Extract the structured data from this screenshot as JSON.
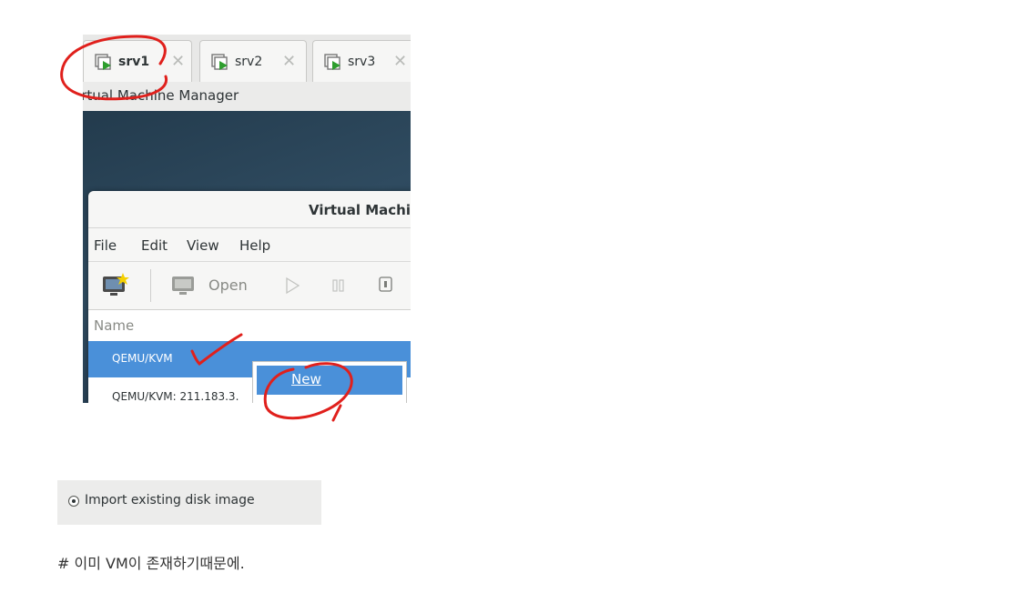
{
  "tabs": [
    {
      "label": "srv1",
      "active": true
    },
    {
      "label": "srv2",
      "active": false
    },
    {
      "label": "srv3",
      "active": false
    }
  ],
  "app_title_partial": "irtual Machine Manager",
  "window_title_partial": "Virtual Machir",
  "menu": [
    "File",
    "Edit",
    "View",
    "Help"
  ],
  "toolbar": {
    "open_label": "Open"
  },
  "list": {
    "column_header": "Name",
    "rows": [
      "QEMU/KVM",
      "QEMU/KVM: 211.183.3."
    ]
  },
  "context_menu": {
    "new_label": "New"
  },
  "radio_option": {
    "label": "Import existing disk image",
    "selected": true
  },
  "note": "# 이미 VM이 존재하기때문에.",
  "colors": {
    "selection": "#4a90d9",
    "annotation": "#e0201c",
    "play_green": "#2e9e2e"
  }
}
